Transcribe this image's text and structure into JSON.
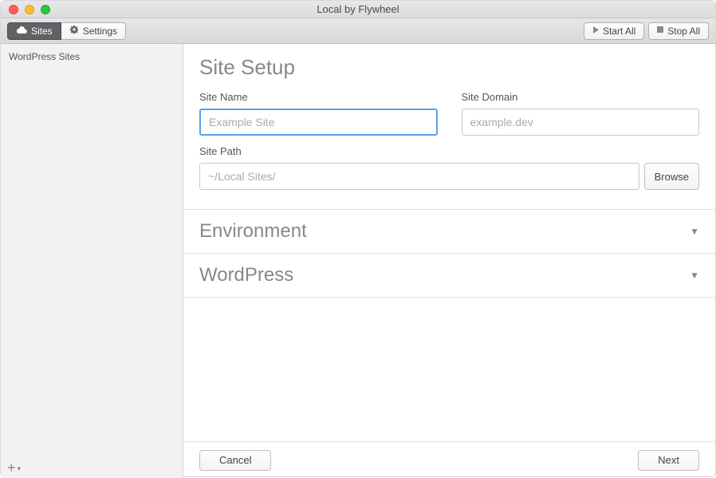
{
  "window": {
    "title": "Local by Flywheel"
  },
  "toolbar": {
    "sites_label": "Sites",
    "settings_label": "Settings",
    "start_all_label": "Start All",
    "stop_all_label": "Stop All"
  },
  "sidebar": {
    "header": "WordPress Sites",
    "add_icon": "+"
  },
  "setup": {
    "title": "Site Setup",
    "site_name": {
      "label": "Site Name",
      "placeholder": "Example Site",
      "value": ""
    },
    "site_domain": {
      "label": "Site Domain",
      "placeholder": "example.dev",
      "value": ""
    },
    "site_path": {
      "label": "Site Path",
      "placeholder": "~/Local Sites/",
      "value": "",
      "browse_label": "Browse"
    },
    "accordion": {
      "environment": "Environment",
      "wordpress": "WordPress"
    }
  },
  "footer": {
    "cancel_label": "Cancel",
    "next_label": "Next"
  }
}
